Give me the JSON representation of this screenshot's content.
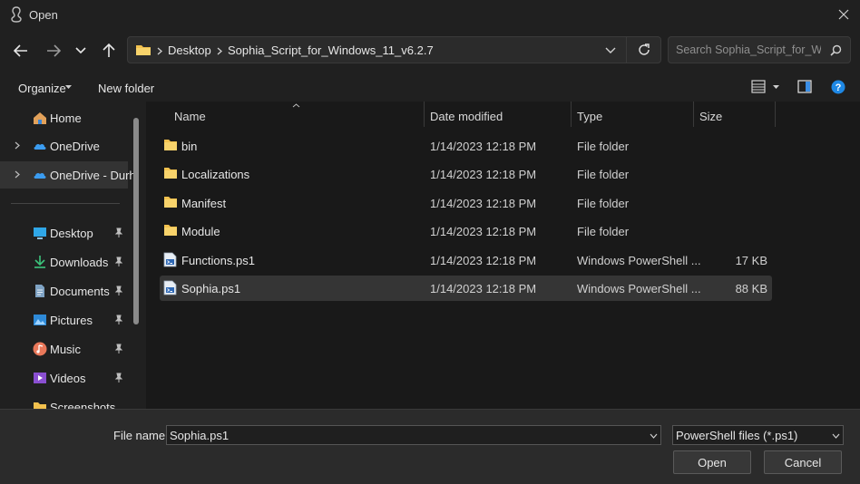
{
  "window": {
    "title": "Open"
  },
  "address": {
    "crumbs": [
      "Desktop",
      "Sophia_Script_for_Windows_11_v6.2.7"
    ]
  },
  "search": {
    "placeholder": "Search Sophia_Script_for_Wi..."
  },
  "toolbar": {
    "organize": "Organize",
    "new_folder": "New folder"
  },
  "sidebar": {
    "items": [
      {
        "label": "Home",
        "icon": "home-icon"
      },
      {
        "label": "OneDrive",
        "icon": "onedrive-icon"
      },
      {
        "label": "OneDrive - Durh",
        "icon": "onedrive-icon"
      },
      {
        "label": "Desktop",
        "icon": "desktop-icon"
      },
      {
        "label": "Downloads",
        "icon": "downloads-icon"
      },
      {
        "label": "Documents",
        "icon": "documents-icon"
      },
      {
        "label": "Pictures",
        "icon": "pictures-icon"
      },
      {
        "label": "Music",
        "icon": "music-icon"
      },
      {
        "label": "Videos",
        "icon": "videos-icon"
      },
      {
        "label": "Screenshots",
        "icon": "folder-icon"
      }
    ]
  },
  "columns": {
    "name": "Name",
    "date": "Date modified",
    "type": "Type",
    "size": "Size"
  },
  "files": [
    {
      "name": "bin",
      "date": "1/14/2023 12:18 PM",
      "type": "File folder",
      "size": "",
      "icon": "folder-icon"
    },
    {
      "name": "Localizations",
      "date": "1/14/2023 12:18 PM",
      "type": "File folder",
      "size": "",
      "icon": "folder-icon"
    },
    {
      "name": "Manifest",
      "date": "1/14/2023 12:18 PM",
      "type": "File folder",
      "size": "",
      "icon": "folder-icon"
    },
    {
      "name": "Module",
      "date": "1/14/2023 12:18 PM",
      "type": "File folder",
      "size": "",
      "icon": "folder-icon"
    },
    {
      "name": "Functions.ps1",
      "date": "1/14/2023 12:18 PM",
      "type": "Windows PowerShell ...",
      "size": "17 KB",
      "icon": "powershell-file-icon"
    },
    {
      "name": "Sophia.ps1",
      "date": "1/14/2023 12:18 PM",
      "type": "Windows PowerShell ...",
      "size": "88 KB",
      "icon": "powershell-file-icon",
      "selected": true
    }
  ],
  "footer": {
    "file_name_label": "File name:",
    "file_name_value": "Sophia.ps1",
    "file_type": "PowerShell files (*.ps1)",
    "open_label": "Open",
    "cancel_label": "Cancel"
  },
  "colors": {
    "accent": "#0078d4",
    "folder": "#f2c14e",
    "background": "#202020"
  }
}
